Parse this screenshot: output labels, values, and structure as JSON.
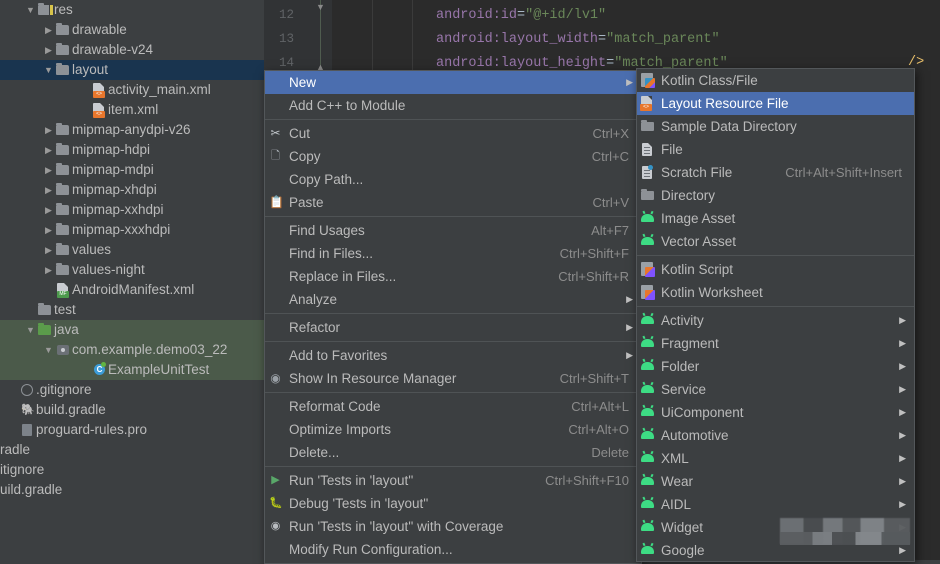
{
  "tree": {
    "items": [
      {
        "label": "res",
        "indent": 1,
        "arrow": "v",
        "icon": "folder-res-icon",
        "state": "normal"
      },
      {
        "label": "drawable",
        "indent": 2,
        "arrow": ">",
        "icon": "folder-icon",
        "state": "normal"
      },
      {
        "label": "drawable-v24",
        "indent": 2,
        "arrow": ">",
        "icon": "folder-icon",
        "state": "normal"
      },
      {
        "label": "layout",
        "indent": 2,
        "arrow": "v",
        "icon": "folder-icon",
        "state": "selected"
      },
      {
        "label": "activity_main.xml",
        "indent": 4,
        "arrow": "",
        "icon": "xml-file-icon",
        "state": "normal"
      },
      {
        "label": "item.xml",
        "indent": 4,
        "arrow": "",
        "icon": "xml-file-icon",
        "state": "normal"
      },
      {
        "label": "mipmap-anydpi-v26",
        "indent": 2,
        "arrow": ">",
        "icon": "folder-icon",
        "state": "normal"
      },
      {
        "label": "mipmap-hdpi",
        "indent": 2,
        "arrow": ">",
        "icon": "folder-icon",
        "state": "normal"
      },
      {
        "label": "mipmap-mdpi",
        "indent": 2,
        "arrow": ">",
        "icon": "folder-icon",
        "state": "normal"
      },
      {
        "label": "mipmap-xhdpi",
        "indent": 2,
        "arrow": ">",
        "icon": "folder-icon",
        "state": "normal"
      },
      {
        "label": "mipmap-xxhdpi",
        "indent": 2,
        "arrow": ">",
        "icon": "folder-icon",
        "state": "normal"
      },
      {
        "label": "mipmap-xxxhdpi",
        "indent": 2,
        "arrow": ">",
        "icon": "folder-icon",
        "state": "normal"
      },
      {
        "label": "values",
        "indent": 2,
        "arrow": ">",
        "icon": "folder-icon",
        "state": "normal"
      },
      {
        "label": "values-night",
        "indent": 2,
        "arrow": ">",
        "icon": "folder-icon",
        "state": "normal"
      },
      {
        "label": "AndroidManifest.xml",
        "indent": 2,
        "arrow": "",
        "icon": "manifest-file-icon",
        "state": "normal"
      },
      {
        "label": "test",
        "indent": 1,
        "arrow": "",
        "icon": "folder-icon",
        "state": "normal"
      },
      {
        "label": "java",
        "indent": 1,
        "arrow": "v",
        "icon": "folder-green-icon",
        "state": "highlight"
      },
      {
        "label": "com.example.demo03_22",
        "indent": 2,
        "arrow": "v",
        "icon": "package-icon",
        "state": "highlight"
      },
      {
        "label": "ExampleUnitTest",
        "indent": 4,
        "arrow": "",
        "icon": "test-class-icon",
        "state": "highlight"
      },
      {
        "label": ".gitignore",
        "indent": 0,
        "arrow": "",
        "icon": "git-icon",
        "state": "normal"
      },
      {
        "label": "build.gradle",
        "indent": 0,
        "arrow": "",
        "icon": "gradle-icon",
        "state": "normal"
      },
      {
        "label": "proguard-rules.pro",
        "indent": 0,
        "arrow": "",
        "icon": "pro-file-icon",
        "state": "normal"
      },
      {
        "label": "radle",
        "indent": 0,
        "arrow": "",
        "icon": "",
        "state": "clipped"
      },
      {
        "label": "itignore",
        "indent": 0,
        "arrow": "",
        "icon": "",
        "state": "clipped"
      },
      {
        "label": "uild.gradle",
        "indent": 0,
        "arrow": "",
        "icon": "",
        "state": "clipped"
      }
    ]
  },
  "editor": {
    "lines": [
      {
        "num": "12",
        "attr": "android:id",
        "value": "\"@+id/lv1\""
      },
      {
        "num": "13",
        "attr": "android:layout_width",
        "value": "\"match_parent\""
      },
      {
        "num": "14",
        "attr": "android:layout_height",
        "value": "\"match_parent\""
      }
    ],
    "tag_close": "/>"
  },
  "context_menu": {
    "items": [
      {
        "label": "New",
        "key": "",
        "icon": "",
        "submenu": true,
        "highlight": true,
        "mnemonic": "N"
      },
      {
        "type": "item",
        "label": "Add C++ to Module",
        "key": "",
        "icon": "",
        "submenu": false
      },
      {
        "type": "separator"
      },
      {
        "type": "item",
        "label": "Cut",
        "key": "Ctrl+X",
        "icon": "scissors-icon",
        "submenu": false
      },
      {
        "type": "item",
        "label": "Copy",
        "key": "Ctrl+C",
        "icon": "copy-icon",
        "submenu": false
      },
      {
        "type": "item",
        "label": "Copy Path...",
        "key": "",
        "icon": "",
        "submenu": false
      },
      {
        "type": "item",
        "label": "Paste",
        "key": "Ctrl+V",
        "icon": "paste-icon",
        "submenu": false
      },
      {
        "type": "separator"
      },
      {
        "type": "item",
        "label": "Find Usages",
        "key": "Alt+F7",
        "icon": "",
        "submenu": false
      },
      {
        "type": "item",
        "label": "Find in Files...",
        "key": "Ctrl+Shift+F",
        "icon": "",
        "submenu": false
      },
      {
        "type": "item",
        "label": "Replace in Files...",
        "key": "Ctrl+Shift+R",
        "icon": "",
        "submenu": false
      },
      {
        "type": "item",
        "label": "Analyze",
        "key": "",
        "icon": "",
        "submenu": true
      },
      {
        "type": "separator"
      },
      {
        "type": "item",
        "label": "Refactor",
        "key": "",
        "icon": "",
        "submenu": true
      },
      {
        "type": "separator"
      },
      {
        "type": "item",
        "label": "Add to Favorites",
        "key": "",
        "icon": "",
        "submenu": true
      },
      {
        "type": "item",
        "label": "Show In Resource Manager",
        "key": "Ctrl+Shift+T",
        "icon": "resource-manager-icon",
        "submenu": false
      },
      {
        "type": "separator"
      },
      {
        "type": "item",
        "label": "Reformat Code",
        "key": "Ctrl+Alt+L",
        "icon": "",
        "submenu": false
      },
      {
        "type": "item",
        "label": "Optimize Imports",
        "key": "Ctrl+Alt+O",
        "icon": "",
        "submenu": false
      },
      {
        "type": "item",
        "label": "Delete...",
        "key": "Delete",
        "icon": "",
        "submenu": false
      },
      {
        "type": "separator"
      },
      {
        "type": "item",
        "label": "Run 'Tests in 'layout''",
        "key": "Ctrl+Shift+F10",
        "icon": "run-icon",
        "submenu": false
      },
      {
        "type": "item",
        "label": "Debug 'Tests in 'layout''",
        "key": "",
        "icon": "debug-icon",
        "submenu": false
      },
      {
        "type": "item",
        "label": "Run 'Tests in 'layout'' with Coverage",
        "key": "",
        "icon": "coverage-icon",
        "submenu": false
      },
      {
        "type": "item",
        "label": "Modify Run Configuration...",
        "key": "",
        "icon": "",
        "submenu": false
      }
    ]
  },
  "new_submenu": {
    "items": [
      {
        "type": "item",
        "label": "Kotlin Class/File",
        "key": "",
        "icon": "kotlin-file-icon",
        "submenu": false
      },
      {
        "type": "item",
        "label": "Layout Resource File",
        "key": "",
        "icon": "layout-resource-icon",
        "submenu": false,
        "highlight": true
      },
      {
        "type": "item",
        "label": "Sample Data Directory",
        "key": "",
        "icon": "folder-icon",
        "submenu": false
      },
      {
        "type": "item",
        "label": "File",
        "key": "",
        "icon": "file-icon",
        "submenu": false
      },
      {
        "type": "item",
        "label": "Scratch File",
        "key": "Ctrl+Alt+Shift+Insert",
        "icon": "scratch-file-icon",
        "submenu": false
      },
      {
        "type": "item",
        "label": "Directory",
        "key": "",
        "icon": "folder-icon",
        "submenu": false
      },
      {
        "type": "item",
        "label": "Image Asset",
        "key": "",
        "icon": "android-icon",
        "submenu": false
      },
      {
        "type": "item",
        "label": "Vector Asset",
        "key": "",
        "icon": "android-icon",
        "submenu": false
      },
      {
        "type": "separator"
      },
      {
        "type": "item",
        "label": "Kotlin Script",
        "key": "",
        "icon": "kotlin-script-icon",
        "submenu": false
      },
      {
        "type": "item",
        "label": "Kotlin Worksheet",
        "key": "",
        "icon": "kotlin-script-icon",
        "submenu": false
      },
      {
        "type": "separator"
      },
      {
        "type": "item",
        "label": "Activity",
        "key": "",
        "icon": "android-icon",
        "submenu": true
      },
      {
        "type": "item",
        "label": "Fragment",
        "key": "",
        "icon": "android-icon",
        "submenu": true
      },
      {
        "type": "item",
        "label": "Folder",
        "key": "",
        "icon": "android-icon",
        "submenu": true
      },
      {
        "type": "item",
        "label": "Service",
        "key": "",
        "icon": "android-icon",
        "submenu": true
      },
      {
        "type": "item",
        "label": "UiComponent",
        "key": "",
        "icon": "android-icon",
        "submenu": true
      },
      {
        "type": "item",
        "label": "Automotive",
        "key": "",
        "icon": "android-icon",
        "submenu": true
      },
      {
        "type": "item",
        "label": "XML",
        "key": "",
        "icon": "android-icon",
        "submenu": true
      },
      {
        "type": "item",
        "label": "Wear",
        "key": "",
        "icon": "android-icon",
        "submenu": true
      },
      {
        "type": "item",
        "label": "AIDL",
        "key": "",
        "icon": "android-icon",
        "submenu": true
      },
      {
        "type": "item",
        "label": "Widget",
        "key": "",
        "icon": "android-icon",
        "submenu": true
      },
      {
        "type": "item",
        "label": "Google",
        "key": "",
        "icon": "android-icon",
        "submenu": true
      }
    ]
  },
  "colors": {
    "selection_blue": "#4b6eaf",
    "tree_selection": "#19344f",
    "tree_highlight_green": "#4b5a4a",
    "menu_bg": "#3c3f41",
    "editor_bg": "#2b2b2b",
    "attribute": "#9876aa",
    "string": "#6a8759",
    "android_green": "#3ddc84"
  }
}
